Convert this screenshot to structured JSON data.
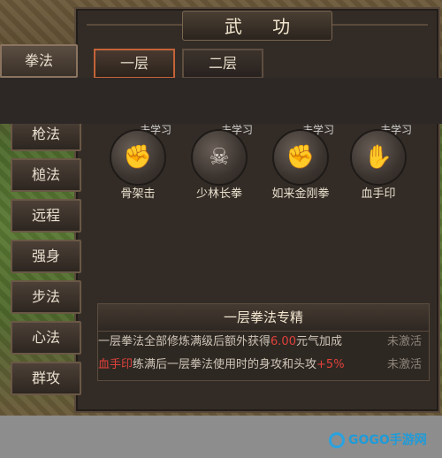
{
  "window": {
    "title": "武  功"
  },
  "tabs": [
    {
      "label": "一层",
      "active": true
    },
    {
      "label": "二层",
      "active": false
    }
  ],
  "sidebar": {
    "items": [
      {
        "label": "拳法",
        "active": true
      },
      {
        "label": "枪法"
      },
      {
        "label": "槌法"
      },
      {
        "label": "远程"
      },
      {
        "label": "强身"
      },
      {
        "label": "步法"
      },
      {
        "label": "心法"
      },
      {
        "label": "群攻"
      }
    ]
  },
  "skills": [
    {
      "status": "未学习",
      "name": "骨架击",
      "icon": "fist-icon"
    },
    {
      "status": "未学习",
      "name": "少林长拳",
      "icon": "skull-crossbones-icon"
    },
    {
      "status": "未学习",
      "name": "如来金刚拳",
      "icon": "impact-fist-icon"
    },
    {
      "status": "未学习",
      "name": "血手印",
      "icon": "bloody-hand-icon"
    }
  ],
  "specialization": {
    "title": "一层拳法专精",
    "rows": [
      {
        "prefix": "一层拳法全部修炼满级后额外获得",
        "highlight": "6.00",
        "suffix": "元气加成",
        "status": "未激活"
      },
      {
        "prefix": "",
        "highlight": "血手印",
        "suffix": "练满后一层拳法使用时的身攻和头攻",
        "highlight2": "+5%",
        "status": "未激活"
      }
    ]
  },
  "watermark": {
    "text": "GOGO手游网"
  },
  "colors": {
    "accent": "#c36338",
    "highlight": "#e0413a"
  }
}
